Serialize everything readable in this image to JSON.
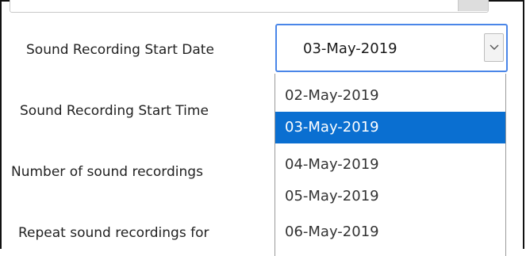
{
  "form": {
    "labels": [
      "Sound Recording Start Date",
      "Sound Recording Start Time",
      "Number of sound recordings",
      "Repeat sound recordings for"
    ]
  },
  "start_date_select": {
    "value": "03-May-2019",
    "icon": "chevron-down-icon",
    "options": [
      "02-May-2019",
      "03-May-2019",
      "04-May-2019",
      "05-May-2019",
      "06-May-2019"
    ],
    "selected_option": "03-May-2019"
  },
  "colors": {
    "focus_border": "#4a86e8",
    "selected_bg": "#0a6fd1",
    "selected_text": "#ffffff"
  }
}
